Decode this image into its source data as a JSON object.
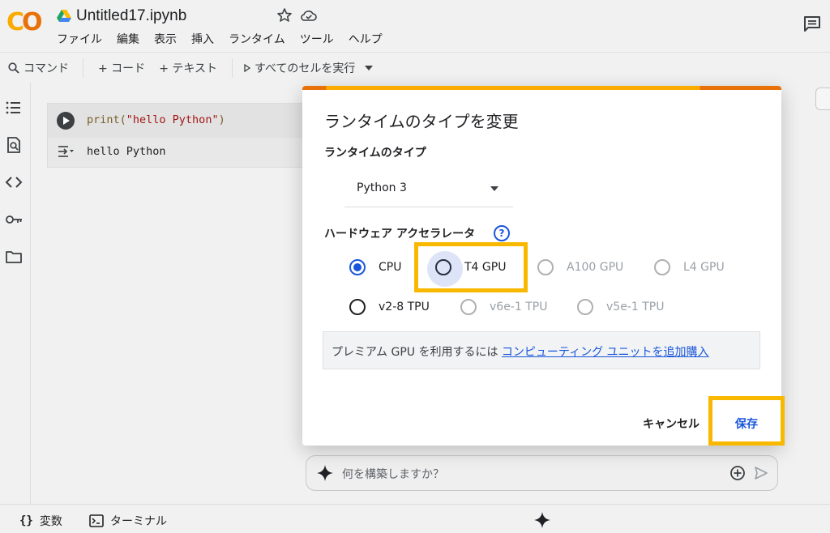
{
  "header": {
    "logo_left": "C",
    "logo_right": "O",
    "title": "Untitled17.ipynb",
    "menu": [
      "ファイル",
      "編集",
      "表示",
      "挿入",
      "ランタイム",
      "ツール",
      "ヘルプ"
    ]
  },
  "toolbar": {
    "command": "コマンド",
    "code": "+ コード",
    "text": "+ テキスト",
    "run_all": "すべてのセルを実行"
  },
  "cell": {
    "code_fn": "print(",
    "code_str": "\"hello Python\"",
    "code_end": ")",
    "output": "hello Python"
  },
  "ai_bar": {
    "placeholder": "何を構築しますか？"
  },
  "statusbar": {
    "variables": "変数",
    "terminal": "ターミナル"
  },
  "dialog": {
    "title": "ランタイムのタイプを変更",
    "runtime_label": "ランタイムのタイプ",
    "runtime_value": "Python 3",
    "hardware_label": "ハードウェア アクセラレータ",
    "help": "?",
    "options": [
      {
        "label": "CPU",
        "state": "checked"
      },
      {
        "label": "T4 GPU",
        "state": "focused"
      },
      {
        "label": "A100 GPU",
        "state": "disabled"
      },
      {
        "label": "L4 GPU",
        "state": "disabled"
      },
      {
        "label": "v2-8 TPU",
        "state": "enabled"
      },
      {
        "label": "v6e-1 TPU",
        "state": "disabled"
      },
      {
        "label": "v5e-1 TPU",
        "state": "disabled"
      }
    ],
    "premium_text": "プレミアム GPU を利用するには ",
    "premium_link": "コンピューティング ユニットを追加購入",
    "cancel": "キャンセル",
    "save": "保存"
  },
  "colors": {
    "accent_blue": "#1a56db",
    "highlight": "#f9b800",
    "logo_yellow": "#f9ab00",
    "logo_orange": "#e8710a"
  }
}
